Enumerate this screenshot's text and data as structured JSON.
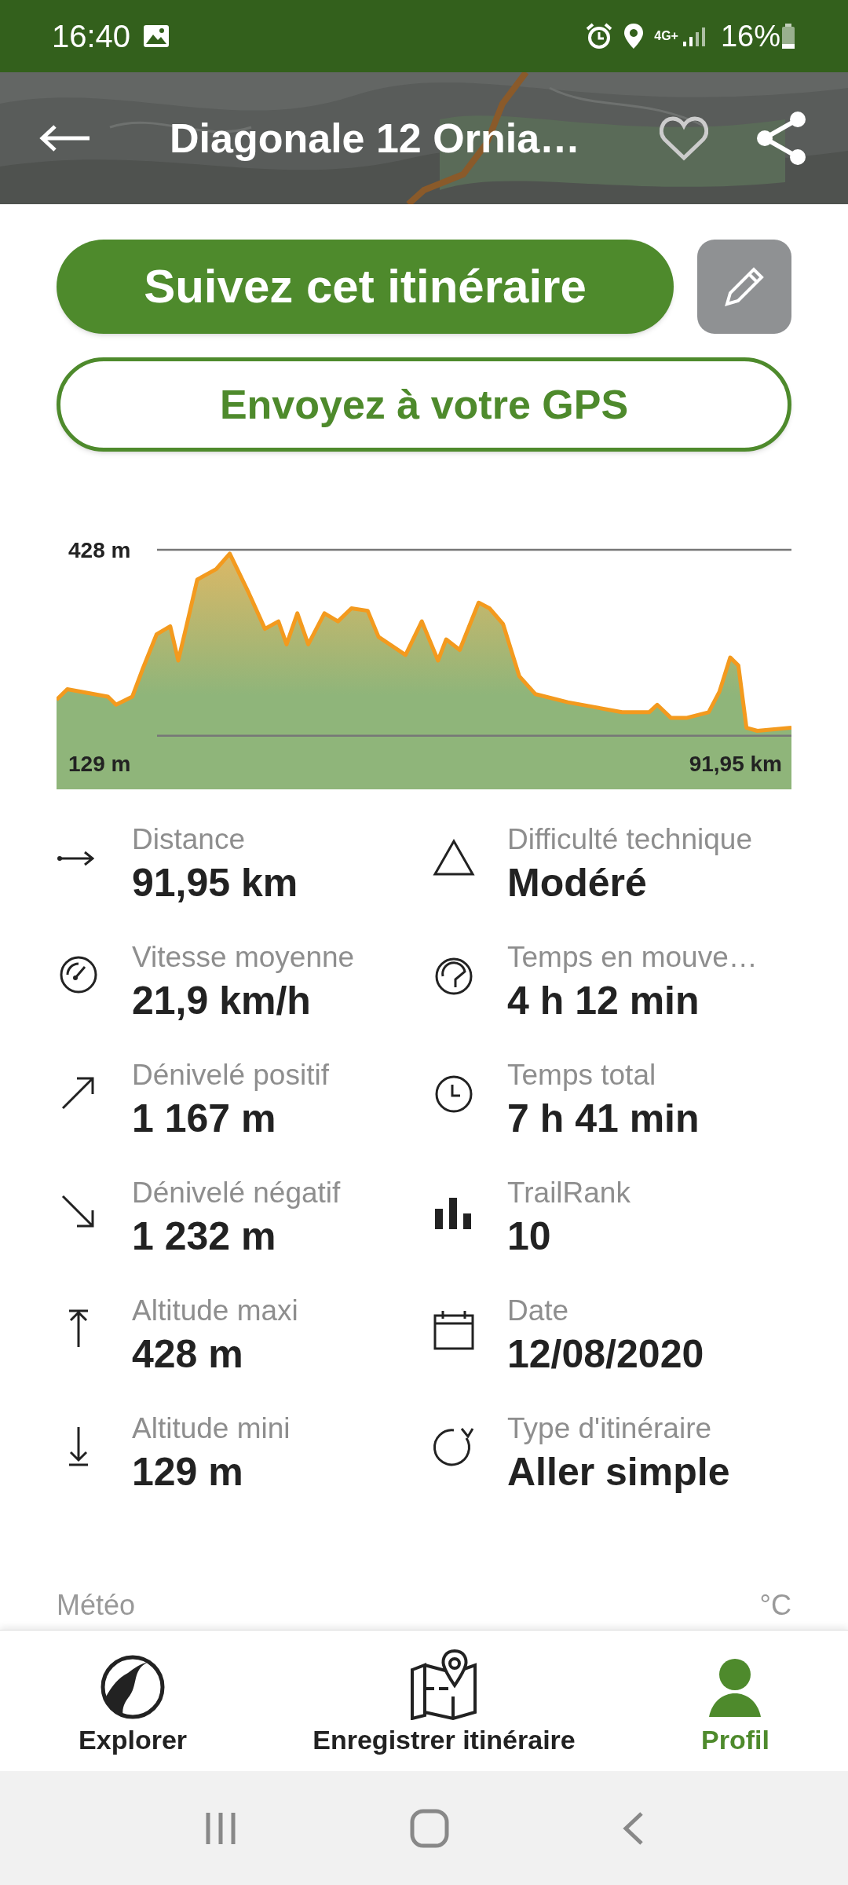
{
  "status_bar": {
    "time": "16:40",
    "network": "4G+",
    "battery": "16%"
  },
  "header": {
    "title": "Diagonale 12 Ornia…",
    "favorite": false
  },
  "actions": {
    "follow": "Suivez cet itinéraire",
    "send": "Envoyez à votre GPS"
  },
  "profile": {
    "max_altitude": "428 m",
    "min_altitude": "129 m",
    "total_distance": "91,95 km"
  },
  "stats": {
    "left": [
      {
        "label": "Distance",
        "value": "91,95 km"
      },
      {
        "label": "Vitesse moyenne",
        "value": "21,9 km/h"
      },
      {
        "label": "Dénivelé positif",
        "value": "1 167 m"
      },
      {
        "label": "Dénivelé négatif",
        "value": "1 232 m"
      },
      {
        "label": "Altitude maxi",
        "value": "428 m"
      },
      {
        "label": "Altitude mini",
        "value": "129 m"
      }
    ],
    "right": [
      {
        "label": "Difficulté technique",
        "value": "Modéré"
      },
      {
        "label": "Temps en mouve…",
        "value": "4 h 12 min"
      },
      {
        "label": "Temps total",
        "value": "7 h 41 min"
      },
      {
        "label": "TrailRank",
        "value": "10"
      },
      {
        "label": "Date",
        "value": "12/08/2020"
      },
      {
        "label": "Type d'itinéraire",
        "value": "Aller simple"
      }
    ]
  },
  "weather": {
    "label": "Météo",
    "unit": "°C"
  },
  "bottom_nav": [
    {
      "label": "Explorer",
      "selected": false
    },
    {
      "label": "Enregistrer itinéraire",
      "selected": false
    },
    {
      "label": "Profil",
      "selected": true
    }
  ]
}
